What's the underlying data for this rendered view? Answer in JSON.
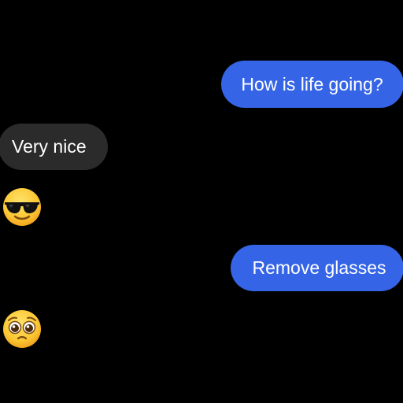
{
  "colors": {
    "background": "#000000",
    "outgoing_bubble": "#3565e6",
    "incoming_bubble": "#2b2b2b",
    "text": "#ffffff"
  },
  "messages": [
    {
      "sender": "me",
      "type": "text",
      "text": "How is life going?"
    },
    {
      "sender": "other",
      "type": "text",
      "text": "Very nice"
    },
    {
      "sender": "other",
      "type": "emoji",
      "icon": "sunglasses-emoji-icon"
    },
    {
      "sender": "me",
      "type": "text",
      "text": "Remove glasses"
    },
    {
      "sender": "other",
      "type": "emoji",
      "icon": "pleading-face-emoji-icon"
    }
  ]
}
